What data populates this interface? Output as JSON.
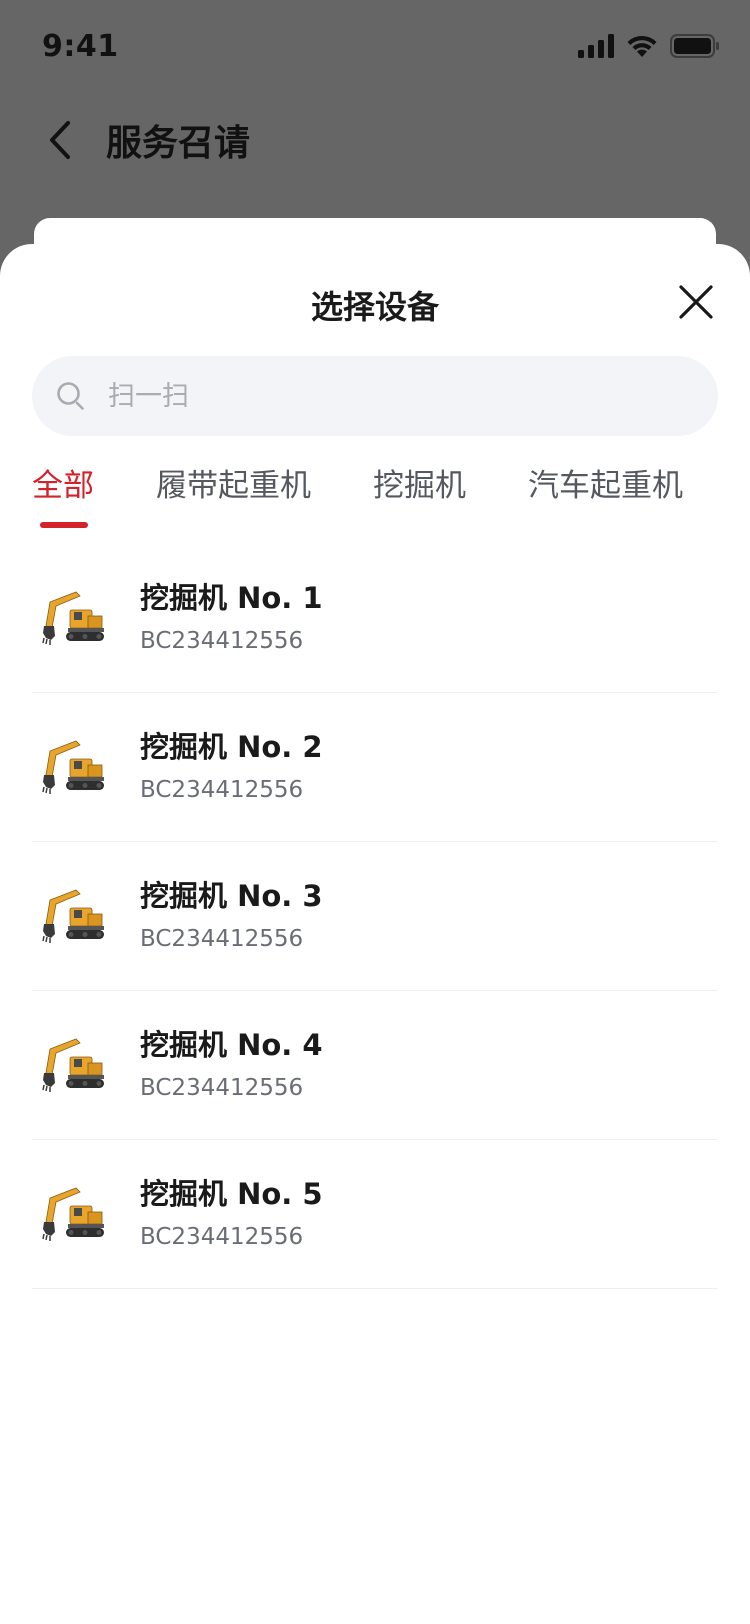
{
  "status_bar": {
    "time": "9:41",
    "icons": [
      "signal-icon",
      "wifi-icon",
      "battery-icon"
    ]
  },
  "nav": {
    "back_icon": "chevron-left-icon",
    "title": "服务召请"
  },
  "sheet": {
    "title": "选择设备",
    "close_icon": "close-icon",
    "search": {
      "icon": "search-icon",
      "placeholder": "扫一扫",
      "value": ""
    },
    "tabs": [
      {
        "label": "全部",
        "active": true
      },
      {
        "label": "履带起重机",
        "active": false
      },
      {
        "label": "挖掘机",
        "active": false
      },
      {
        "label": "汽车起重机",
        "active": false
      }
    ],
    "devices": [
      {
        "name": "挖掘机 No. 1",
        "code": "BC234412556",
        "image": "excavator-image"
      },
      {
        "name": "挖掘机 No. 2",
        "code": "BC234412556",
        "image": "excavator-image"
      },
      {
        "name": "挖掘机 No. 3",
        "code": "BC234412556",
        "image": "excavator-image"
      },
      {
        "name": "挖掘机 No. 4",
        "code": "BC234412556",
        "image": "excavator-image"
      },
      {
        "name": "挖掘机 No. 5",
        "code": "BC234412556",
        "image": "excavator-image"
      }
    ]
  },
  "colors": {
    "accent": "#d3222a",
    "overlay": "rgba(0,0,0,0.58)",
    "search_bg": "#f3f4f8",
    "excavator_yellow": "#e8a52c"
  }
}
